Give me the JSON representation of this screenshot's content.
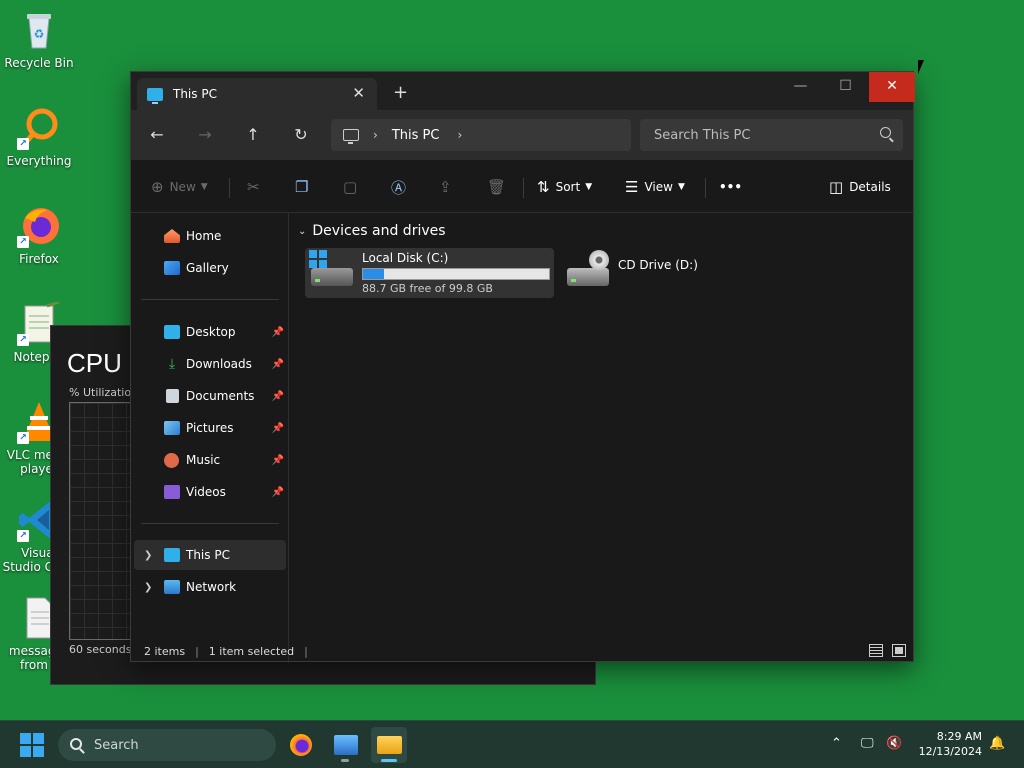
{
  "desktop": {
    "icons": [
      {
        "label": "Recycle Bin"
      },
      {
        "label": "Everything"
      },
      {
        "label": "Firefox"
      },
      {
        "label": "Notepad"
      },
      {
        "label": "VLC media player"
      },
      {
        "label": "Visual Studio Code"
      },
      {
        "label": "messages from s"
      }
    ]
  },
  "task_manager": {
    "title": "CPU",
    "utilization_label": "% Utilization",
    "time_label": "60 seconds"
  },
  "explorer": {
    "tab_title": "This PC",
    "tab_close": "✕",
    "new_tab": "+",
    "window_buttons": {
      "minimize": "—",
      "maximize": "☐",
      "close": "✕"
    },
    "nav": {
      "back": "←",
      "forward": "→",
      "up": "↑",
      "refresh": "↻"
    },
    "address": {
      "crumb": "This PC",
      "chevron": "›"
    },
    "search": {
      "placeholder": "Search This PC"
    },
    "toolbar": {
      "new_label": "New",
      "sort_label": "Sort",
      "view_label": "View",
      "more_label": "•••",
      "details_label": "Details"
    },
    "sidebar": {
      "home": "Home",
      "gallery": "Gallery",
      "pinned": [
        {
          "label": "Desktop",
          "color": "#2fb0e8"
        },
        {
          "label": "Downloads",
          "color": "#32b96b"
        },
        {
          "label": "Documents",
          "color": "#cfd6dc"
        },
        {
          "label": "Pictures",
          "color": "#3a9ee0"
        },
        {
          "label": "Music",
          "color": "#e0694a"
        },
        {
          "label": "Videos",
          "color": "#8a5bd6"
        }
      ],
      "this_pc": "This PC",
      "network": "Network"
    },
    "group_title": "Devices and drives",
    "drives": [
      {
        "name": "Local Disk (C:)",
        "free_text": "88.7 GB free of 99.8 GB",
        "used_fraction": 0.111
      },
      {
        "name": "CD Drive (D:)"
      }
    ],
    "status": {
      "items": "2 items",
      "selected": "1 item selected"
    }
  },
  "taskbar": {
    "search_label": "Search",
    "time": "8:29 AM",
    "date": "12/13/2024"
  }
}
